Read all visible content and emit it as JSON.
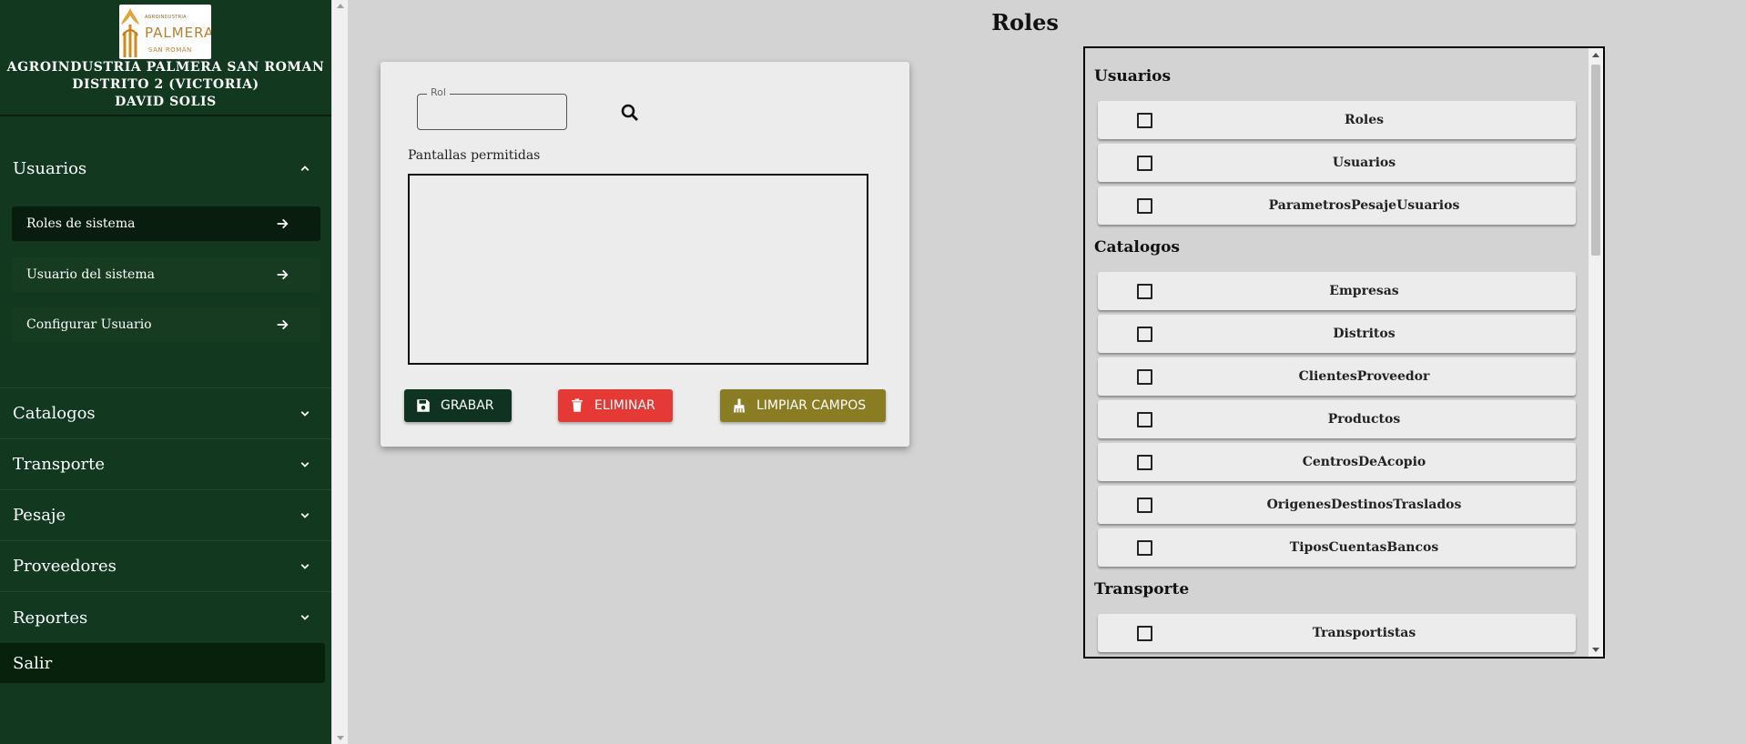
{
  "header": {
    "logo": {
      "top_text": "AGROINDUSTRIA",
      "main_text": "PALMERA",
      "sub_text": "SAN ROMAN"
    },
    "company": "AGROINDUSTRIA PALMERA SAN ROMAN",
    "district": "DISTRITO 2 (VICTORIA)",
    "user": "DAVID SOLIS"
  },
  "sidebar": {
    "sections": [
      {
        "label": "Usuarios",
        "expanded": true,
        "items": [
          {
            "label": "Roles de sistema",
            "active": true
          },
          {
            "label": "Usuario del sistema",
            "active": false
          },
          {
            "label": "Configurar Usuario",
            "active": false
          }
        ]
      },
      {
        "label": "Catalogos",
        "expanded": false
      },
      {
        "label": "Transporte",
        "expanded": false
      },
      {
        "label": "Pesaje",
        "expanded": false
      },
      {
        "label": "Proveedores",
        "expanded": false
      },
      {
        "label": "Reportes",
        "expanded": false
      }
    ],
    "logout": "Salir"
  },
  "page": {
    "title": "Roles"
  },
  "form": {
    "rol_label": "Rol",
    "rol_value": "",
    "permitted_label": "Pantallas permitidas",
    "buttons": {
      "save": "GRABAR",
      "delete": "ELIMINAR",
      "clear": "LIMPIAR CAMPOS"
    }
  },
  "permissions": {
    "groups": [
      {
        "title": "Usuarios",
        "items": [
          "Roles",
          "Usuarios",
          "ParametrosPesajeUsuarios"
        ]
      },
      {
        "title": "Catalogos",
        "items": [
          "Empresas",
          "Distritos",
          "ClientesProveedor",
          "Productos",
          "CentrosDeAcopio",
          "OrigenesDestinosTraslados",
          "TiposCuentasBancos"
        ]
      },
      {
        "title": "Transporte",
        "items": [
          "Transportistas"
        ]
      }
    ]
  },
  "colors": {
    "sidebar": "#12391f",
    "save": "#0f3320",
    "delete": "#e53935",
    "clear": "#8a7c23",
    "background": "#d3d3d3"
  }
}
